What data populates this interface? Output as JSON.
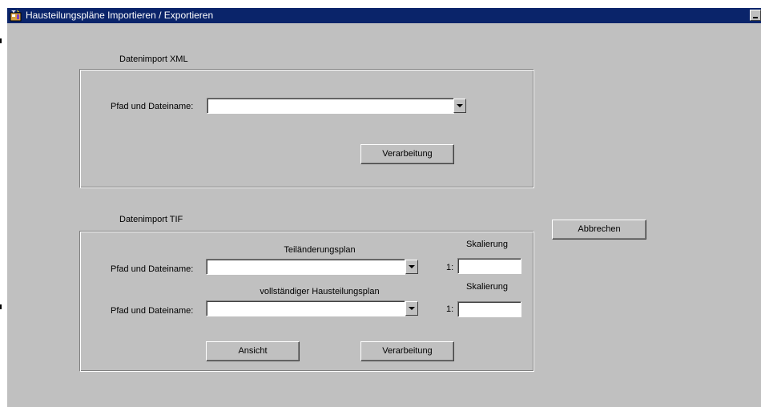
{
  "window": {
    "title": "Hausteilungspläne Importieren / Exportieren"
  },
  "xml_import": {
    "section_label": "Datenimport XML",
    "path_label": "Pfad und Dateiname:",
    "path_value": "",
    "process_button": "Verarbeitung"
  },
  "tif_import": {
    "section_label": "Datenimport TIF",
    "partial_plan": {
      "heading": "Teiländerungsplan",
      "path_label": "Pfad und Dateiname:",
      "path_value": "",
      "scale_heading": "Skalierung",
      "scale_prefix": "1:",
      "scale_value": ""
    },
    "full_plan": {
      "heading": "vollständiger Hausteilungsplan",
      "path_label": "Pfad und Dateiname:",
      "path_value": "",
      "scale_heading": "Skalierung",
      "scale_prefix": "1:",
      "scale_value": ""
    },
    "view_button": "Ansicht",
    "process_button": "Verarbeitung"
  },
  "cancel_button": "Abbrechen",
  "icons": {
    "title_icon": "app-window-icon",
    "combo_arrow": "chevron-down-icon"
  }
}
